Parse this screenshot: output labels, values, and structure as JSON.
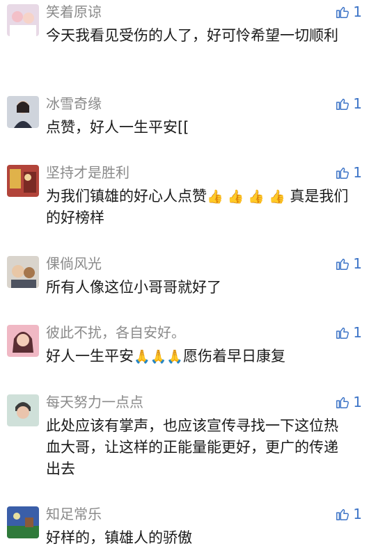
{
  "comments": [
    {
      "name": "笑着原谅",
      "text": "今天我看见受伤的人了，好可怜希望一切顺利",
      "likes": "1",
      "avatar_colors": [
        "#e8d9e6",
        "#f3c0c8"
      ]
    },
    {
      "name": "冰雪奇缘",
      "text": "点赞，好人一生平安[[",
      "likes": "1",
      "avatar_colors": [
        "#cfd4dc",
        "#2c3140"
      ]
    },
    {
      "name": "坚持才是胜利",
      "text_parts": [
        "为我们镇雄的好心人点赞",
        "👍 👍 👍 👍",
        " 真是我们的好榜样"
      ],
      "likes": "1",
      "avatar_colors": [
        "#b2443a",
        "#e0b24a"
      ]
    },
    {
      "name": "倮倘风光",
      "text": "所有人像这位小哥哥就好了",
      "likes": "1",
      "avatar_colors": [
        "#d9d4cc",
        "#a5764c"
      ]
    },
    {
      "name": "彼此不扰，各自安好。",
      "text_parts": [
        "好人一生平安",
        "🙏🙏🙏",
        "愿伤着早日康复"
      ],
      "likes": "1",
      "avatar_colors": [
        "#f0b8c4",
        "#5a2e33"
      ]
    },
    {
      "name": "每天努力一点点",
      "text": "此处应该有掌声，也应该宣传寻找一下这位热血大哥，让这样的正能量能更好，更广的传递出去",
      "likes": "1",
      "avatar_colors": [
        "#cfe0d9",
        "#3a3a3a"
      ]
    },
    {
      "name": "知足常乐",
      "text": "好样的，镇雄人的骄傲",
      "likes": "1",
      "avatar_colors": [
        "#3a5ea8",
        "#2f7a3a"
      ]
    }
  ],
  "icons": {
    "like": "thumbs-up-icon"
  },
  "colors": {
    "name": "#8a8a8a",
    "like": "#3d74c7",
    "text": "#1a1a1a"
  }
}
